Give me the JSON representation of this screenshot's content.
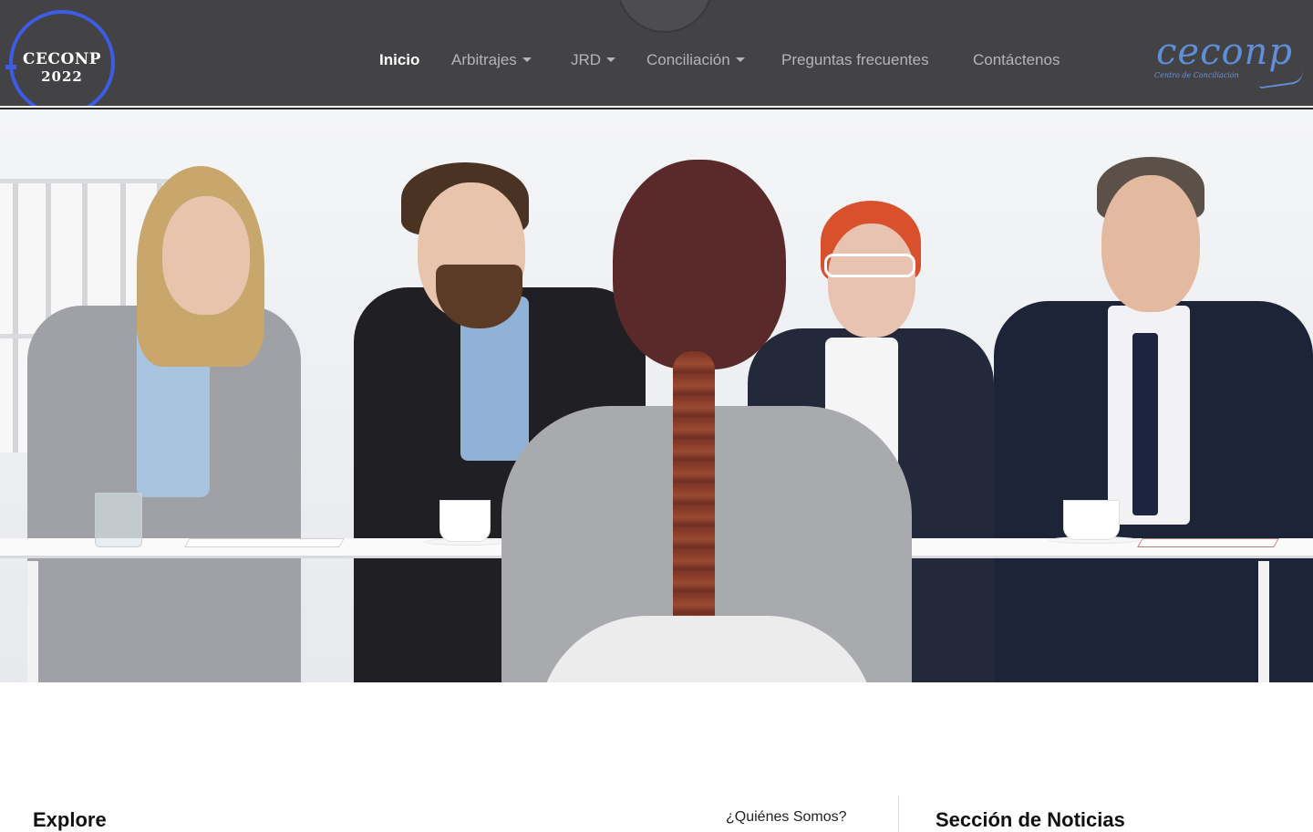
{
  "logo": {
    "line1": "CECONP",
    "line2": "2022"
  },
  "nav": {
    "items": [
      {
        "label": "Inicio",
        "active": true,
        "dropdown": false
      },
      {
        "label": "Arbitrajes",
        "active": false,
        "dropdown": true
      },
      {
        "label": "JRD",
        "active": false,
        "dropdown": true
      },
      {
        "label": "Conciliación",
        "active": false,
        "dropdown": true
      },
      {
        "label": "Preguntas frecuentes",
        "active": false,
        "dropdown": false
      },
      {
        "label": "Contáctenos",
        "active": false,
        "dropdown": false
      }
    ]
  },
  "brand": {
    "name": "ceconp",
    "tagline": "Centro de Conciliación"
  },
  "colors": {
    "navbar": "#434245",
    "accent": "#3b5ce3",
    "brand_script": "#5f8fd8",
    "nav_text": "#b5b5b8",
    "nav_active": "#ffffff"
  },
  "hero": {
    "image_subject": "job-interview-panel-photo"
  },
  "footer_preview": {
    "explore_title": "Explore",
    "about_link": "¿Quiénes Somos?",
    "news_title": "Sección de Noticias"
  }
}
